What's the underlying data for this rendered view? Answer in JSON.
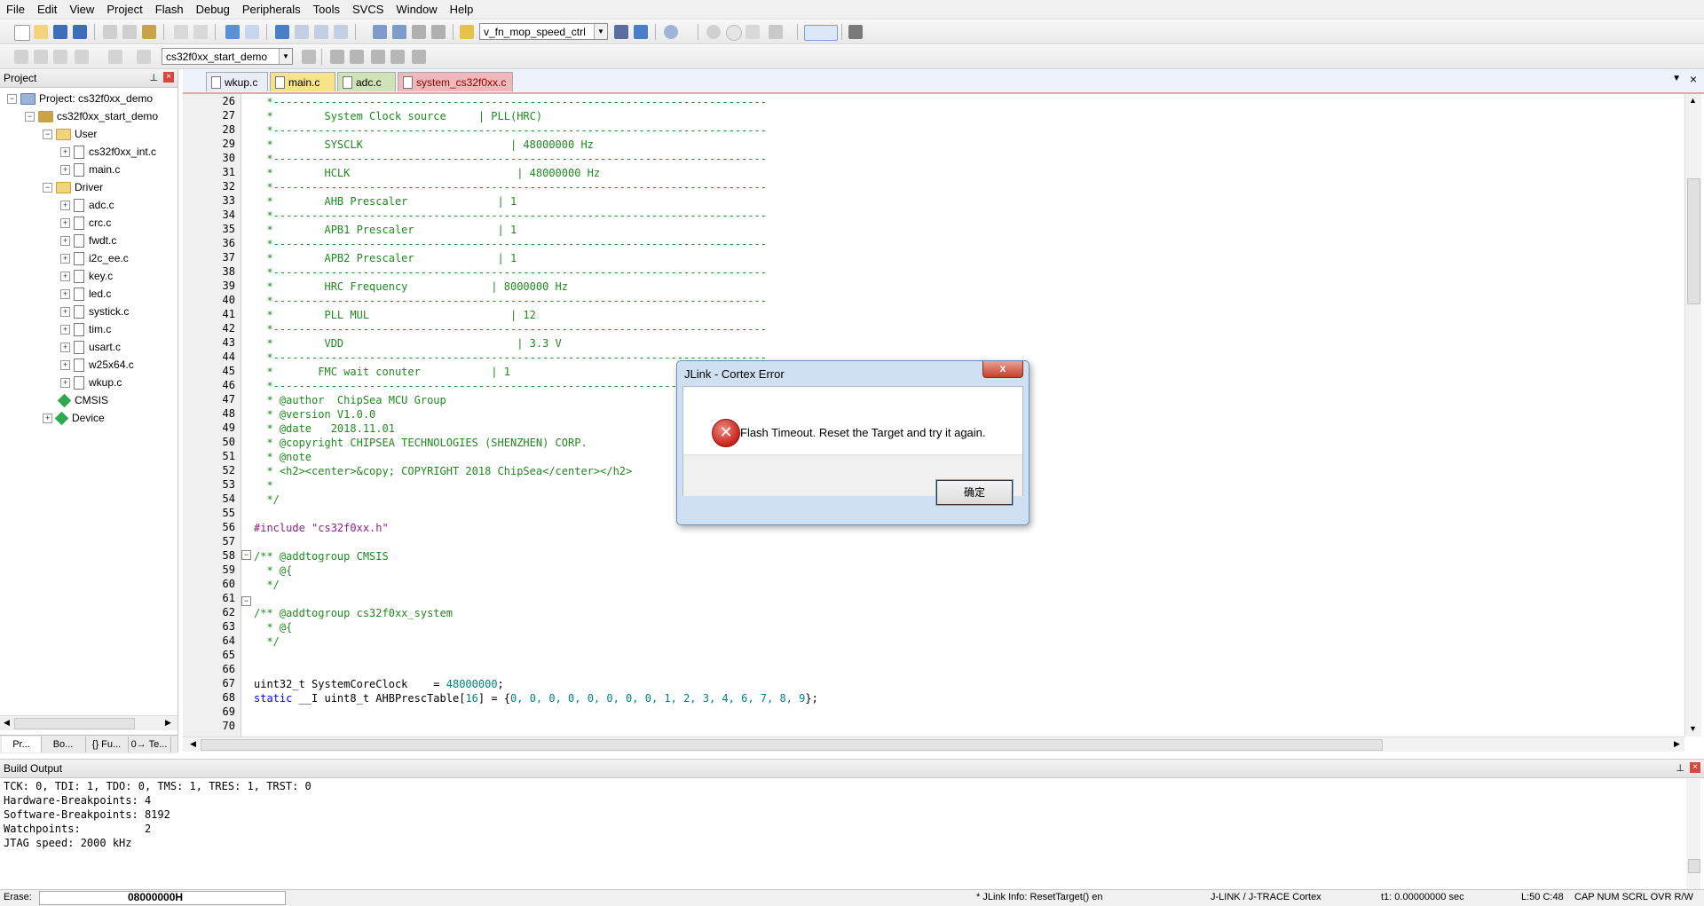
{
  "menu": [
    "File",
    "Edit",
    "View",
    "Project",
    "Flash",
    "Debug",
    "Peripherals",
    "Tools",
    "SVCS",
    "Window",
    "Help"
  ],
  "toolbar": {
    "function_combo": "v_fn_mop_speed_ctrl",
    "target_combo": "cs32f0xx_start_demo"
  },
  "project_panel": {
    "title": "Project",
    "root": "Project: cs32f0xx_demo",
    "target": "cs32f0xx_start_demo",
    "groups": [
      {
        "name": "User",
        "files": [
          "cs32f0xx_int.c",
          "main.c"
        ]
      },
      {
        "name": "Driver",
        "files": [
          "adc.c",
          "crc.c",
          "fwdt.c",
          "i2c_ee.c",
          "key.c",
          "led.c",
          "systick.c",
          "tim.c",
          "usart.c",
          "w25x64.c",
          "wkup.c"
        ]
      }
    ],
    "components": [
      "CMSIS",
      "Device"
    ],
    "bottom_tabs": [
      "Pr...",
      "Bo...",
      "{} Fu...",
      "0→ Te..."
    ]
  },
  "tabs": [
    "wkup.c",
    "main.c",
    "adc.c",
    "system_cs32f0xx.c"
  ],
  "editor": {
    "lines": [
      {
        "n": "26",
        "t": "  *-----------------------------------------------------------------------------",
        "c": "c-green"
      },
      {
        "n": "27",
        "t": "  *        System Clock source     | PLL(HRC)",
        "c": "c-green"
      },
      {
        "n": "28",
        "t": "  *-----------------------------------------------------------------------------",
        "c": "c-green"
      },
      {
        "n": "29",
        "t": "  *        SYSCLK                       | 48000000 Hz",
        "c": "c-green"
      },
      {
        "n": "30",
        "t": "  *-----------------------------------------------------------------------------",
        "c": "c-green"
      },
      {
        "n": "31",
        "t": "  *        HCLK                          | 48000000 Hz",
        "c": "c-green"
      },
      {
        "n": "32",
        "t": "  *-----------------------------------------------------------------------------",
        "c": "c-green"
      },
      {
        "n": "33",
        "t": "  *        AHB Prescaler              | 1",
        "c": "c-green"
      },
      {
        "n": "34",
        "t": "  *-----------------------------------------------------------------------------",
        "c": "c-green"
      },
      {
        "n": "35",
        "t": "  *        APB1 Prescaler             | 1",
        "c": "c-green"
      },
      {
        "n": "36",
        "t": "  *-----------------------------------------------------------------------------",
        "c": "c-green"
      },
      {
        "n": "37",
        "t": "  *        APB2 Prescaler             | 1",
        "c": "c-green"
      },
      {
        "n": "38",
        "t": "  *-----------------------------------------------------------------------------",
        "c": "c-green"
      },
      {
        "n": "39",
        "t": "  *        HRC Frequency             | 8000000 Hz",
        "c": "c-green"
      },
      {
        "n": "40",
        "t": "  *-----------------------------------------------------------------------------",
        "c": "c-green"
      },
      {
        "n": "41",
        "t": "  *        PLL MUL                      | 12",
        "c": "c-green"
      },
      {
        "n": "42",
        "t": "  *-----------------------------------------------------------------------------",
        "c": "c-green"
      },
      {
        "n": "43",
        "t": "  *        VDD                           | 3.3 V",
        "c": "c-green"
      },
      {
        "n": "44",
        "t": "  *-----------------------------------------------------------------------------",
        "c": "c-green"
      },
      {
        "n": "45",
        "t": "  *       FMC wait conuter           | 1",
        "c": "c-green"
      },
      {
        "n": "46",
        "t": "  *------------------------------------------------------------------",
        "c": "c-green"
      },
      {
        "n": "47",
        "t": "  * @author  ChipSea MCU Group",
        "c": "c-green"
      },
      {
        "n": "48",
        "t": "  * @version V1.0.0",
        "c": "c-green"
      },
      {
        "n": "49",
        "t": "  * @date   2018.11.01",
        "c": "c-green"
      },
      {
        "n": "50",
        "t": "  * @copyright CHIPSEA TECHNOLOGIES (SHENZHEN) CORP.",
        "c": "c-green"
      },
      {
        "n": "51",
        "t": "  * @note",
        "c": "c-green"
      },
      {
        "n": "52",
        "t": "  * <h2><center>&copy; COPYRIGHT 2018 ChipSea</center></h2>",
        "c": "c-green"
      },
      {
        "n": "53",
        "t": "  *",
        "c": "c-green"
      },
      {
        "n": "54",
        "t": "  */",
        "c": "c-green"
      },
      {
        "n": "55",
        "t": "",
        "c": ""
      },
      {
        "n": "56",
        "t": "#include \"cs32f0xx.h\"",
        "c": "c-purple"
      },
      {
        "n": "57",
        "t": "",
        "c": ""
      },
      {
        "n": "58",
        "t": "/** @addtogroup CMSIS",
        "c": "c-green"
      },
      {
        "n": "59",
        "t": "  * @{",
        "c": "c-green"
      },
      {
        "n": "60",
        "t": "  */",
        "c": "c-green"
      },
      {
        "n": "61",
        "t": "",
        "c": ""
      },
      {
        "n": "62",
        "t": "/** @addtogroup cs32f0xx_system",
        "c": "c-green"
      },
      {
        "n": "63",
        "t": "  * @{",
        "c": "c-green"
      },
      {
        "n": "64",
        "t": "  */",
        "c": "c-green"
      },
      {
        "n": "65",
        "t": "",
        "c": ""
      },
      {
        "n": "66",
        "t": "",
        "c": ""
      },
      {
        "n": "67",
        "t": "uint32_t SystemCoreClock    = 48000000;",
        "c": "line67"
      },
      {
        "n": "68",
        "t": "static __I uint8_t AHBPrescTable[16] = {0, 0, 0, 0, 0, 0, 0, 0, 1, 2, 3, 4, 6, 7, 8, 9};",
        "c": "line68"
      },
      {
        "n": "69",
        "t": "",
        "c": ""
      },
      {
        "n": "70",
        "t": "",
        "c": ""
      }
    ]
  },
  "build_output": {
    "title": "Build Output",
    "lines": [
      "TCK: 0, TDI: 1, TDO: 0, TMS: 1, TRES: 1, TRST: 0",
      "Hardware-Breakpoints: 4",
      "Software-Breakpoints: 8192",
      "Watchpoints:          2",
      "JTAG speed: 2000 kHz"
    ]
  },
  "status": {
    "erase_label": "Erase:",
    "address": "08000000H",
    "info": "* JLink Info: ResetTarget() en",
    "debugger": "J-LINK / J-TRACE Cortex",
    "time": "t1: 0.00000000 sec",
    "position": "L:50 C:48",
    "indicators": "CAP  NUM  SCRL  OVR  R/W"
  },
  "dialog": {
    "title": "JLink - Cortex Error",
    "message": "Flash Timeout. Reset the Target and try it again.",
    "ok_label": "确定",
    "close_glyph": "x"
  },
  "colors": {
    "accent": "#e8a3a3",
    "comment": "#1f8a1f",
    "keyword": "#0000ff",
    "number": "#008080"
  }
}
